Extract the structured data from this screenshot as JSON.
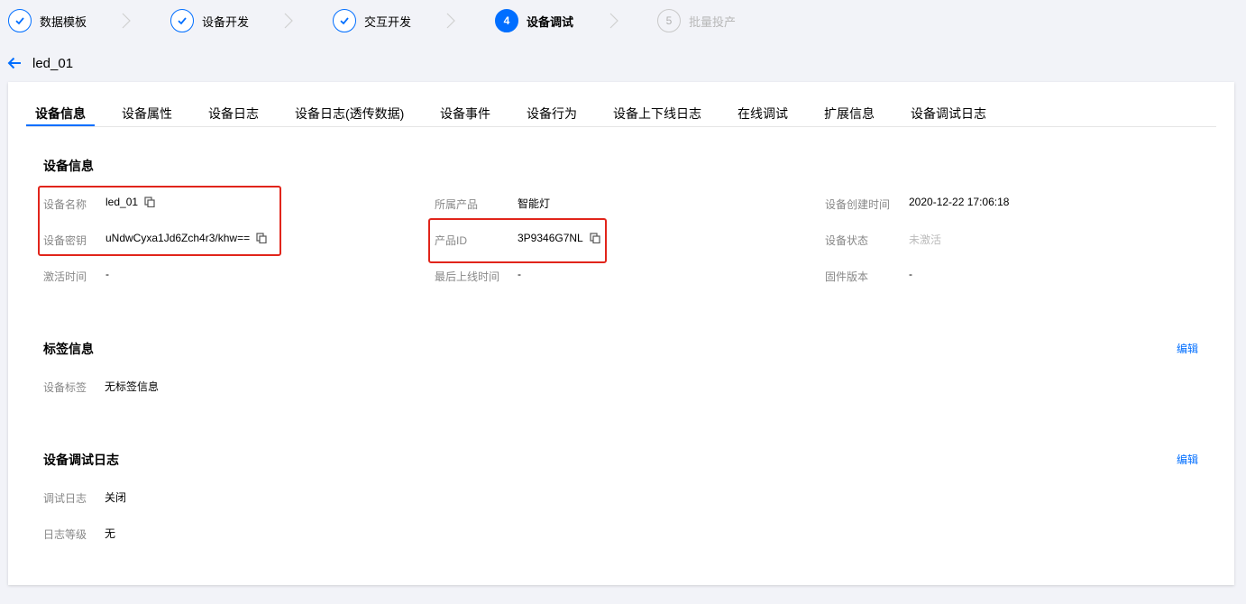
{
  "stepper": {
    "steps": [
      {
        "label": "数据模板",
        "state": "done"
      },
      {
        "label": "设备开发",
        "state": "done"
      },
      {
        "label": "交互开发",
        "state": "done"
      },
      {
        "label": "设备调试",
        "state": "active",
        "number": "4"
      },
      {
        "label": "批量投产",
        "state": "disabled",
        "number": "5"
      }
    ]
  },
  "header": {
    "device_name": "led_01"
  },
  "tabs": [
    {
      "label": "设备信息",
      "active": true
    },
    {
      "label": "设备属性"
    },
    {
      "label": "设备日志"
    },
    {
      "label": "设备日志(透传数据)"
    },
    {
      "label": "设备事件"
    },
    {
      "label": "设备行为"
    },
    {
      "label": "设备上下线日志"
    },
    {
      "label": "在线调试"
    },
    {
      "label": "扩展信息"
    },
    {
      "label": "设备调试日志"
    }
  ],
  "device_info": {
    "title": "设备信息",
    "device_name_label": "设备名称",
    "device_name_value": "led_01",
    "device_key_label": "设备密钥",
    "device_key_value": "uNdwCyxa1Jd6Zch4r3/khw==",
    "activation_time_label": "激活时间",
    "activation_time_value": "-",
    "product_label": "所属产品",
    "product_value": "智能灯",
    "product_id_label": "产品ID",
    "product_id_value": "3P9346G7NL",
    "last_online_label": "最后上线时间",
    "last_online_value": "-",
    "created_label": "设备创建时间",
    "created_value": "2020-12-22 17:06:18",
    "status_label": "设备状态",
    "status_value": "未激活",
    "firmware_label": "固件版本",
    "firmware_value": "-"
  },
  "tag_info": {
    "title": "标签信息",
    "edit_label": "编辑",
    "tag_label": "设备标签",
    "tag_value": "无标签信息"
  },
  "debug_log": {
    "title": "设备调试日志",
    "edit_label": "编辑",
    "log_label": "调试日志",
    "log_value": "关闭",
    "level_label": "日志等级",
    "level_value": "无"
  },
  "colors": {
    "accent": "#006eff",
    "highlight": "#e1251b",
    "background": "#f2f3f8"
  }
}
